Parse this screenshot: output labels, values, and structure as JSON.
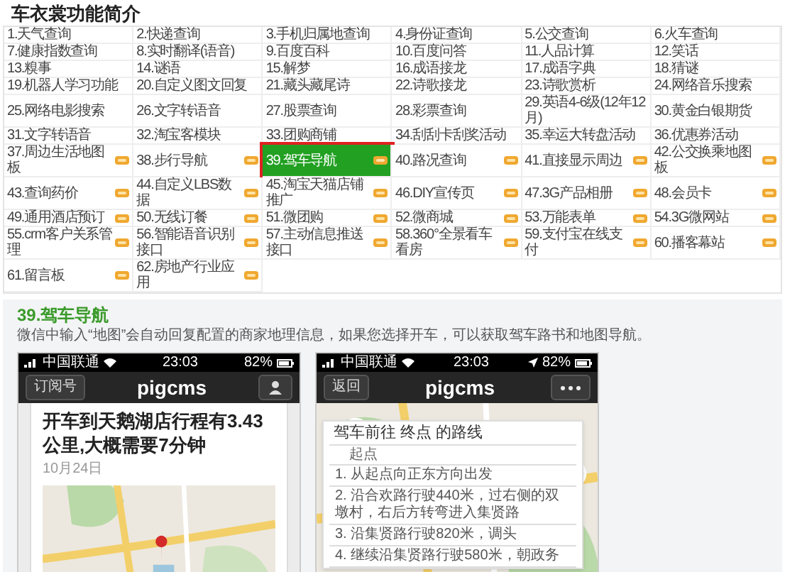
{
  "title": "车衣裳功能简介",
  "features": [
    {
      "label": "1.天气查询",
      "new": false,
      "selected": false
    },
    {
      "label": "2.快递查询",
      "new": false,
      "selected": false
    },
    {
      "label": "3.手机归属地查询",
      "new": false,
      "selected": false
    },
    {
      "label": "4.身份证查询",
      "new": false,
      "selected": false
    },
    {
      "label": "5.公交查询",
      "new": false,
      "selected": false
    },
    {
      "label": "6.火车查询",
      "new": false,
      "selected": false
    },
    {
      "label": "7.健康指数查询",
      "new": false,
      "selected": false
    },
    {
      "label": "8.实时翻译(语音)",
      "new": false,
      "selected": false
    },
    {
      "label": "9.百度百科",
      "new": false,
      "selected": false
    },
    {
      "label": "10.百度问答",
      "new": false,
      "selected": false
    },
    {
      "label": "11.人品计算",
      "new": false,
      "selected": false
    },
    {
      "label": "12.笑话",
      "new": false,
      "selected": false
    },
    {
      "label": "13.糗事",
      "new": false,
      "selected": false
    },
    {
      "label": "14.谜语",
      "new": false,
      "selected": false
    },
    {
      "label": "15.解梦",
      "new": false,
      "selected": false
    },
    {
      "label": "16.成语接龙",
      "new": false,
      "selected": false
    },
    {
      "label": "17.成语字典",
      "new": false,
      "selected": false
    },
    {
      "label": "18.猜谜",
      "new": false,
      "selected": false
    },
    {
      "label": "19.机器人学习功能",
      "new": false,
      "selected": false
    },
    {
      "label": "20.自定义图文回复",
      "new": false,
      "selected": false
    },
    {
      "label": "21.藏头藏尾诗",
      "new": false,
      "selected": false
    },
    {
      "label": "22.诗歌接龙",
      "new": false,
      "selected": false
    },
    {
      "label": "23.诗歌赏析",
      "new": false,
      "selected": false
    },
    {
      "label": "24.网络音乐搜索",
      "new": false,
      "selected": false
    },
    {
      "label": "25.网络电影搜索",
      "new": false,
      "selected": false
    },
    {
      "label": "26.文字转语音",
      "new": false,
      "selected": false
    },
    {
      "label": "27.股票查询",
      "new": false,
      "selected": false
    },
    {
      "label": "28.彩票查询",
      "new": false,
      "selected": false
    },
    {
      "label": "29.英语4-6级(12年12月)",
      "new": false,
      "selected": false
    },
    {
      "label": "30.黄金白银期货",
      "new": false,
      "selected": false
    },
    {
      "label": "31.文字转语音",
      "new": false,
      "selected": false
    },
    {
      "label": "32.淘宝客模块",
      "new": false,
      "selected": false
    },
    {
      "label": "33.团购商铺",
      "new": false,
      "selected": false
    },
    {
      "label": "34.刮刮卡刮奖活动",
      "new": false,
      "selected": false
    },
    {
      "label": "35.幸运大转盘活动",
      "new": false,
      "selected": false
    },
    {
      "label": "36.优惠券活动",
      "new": false,
      "selected": false
    },
    {
      "label": "37.周边生活地图板",
      "new": true,
      "selected": false
    },
    {
      "label": "38.步行导航",
      "new": true,
      "selected": false
    },
    {
      "label": "39.驾车导航",
      "new": true,
      "selected": true
    },
    {
      "label": "40.路况查询",
      "new": true,
      "selected": false
    },
    {
      "label": "41.直接显示周边",
      "new": true,
      "selected": false
    },
    {
      "label": "42.公交换乘地图板",
      "new": true,
      "selected": false
    },
    {
      "label": "43.查询药价",
      "new": true,
      "selected": false
    },
    {
      "label": "44.自定义LBS数据",
      "new": true,
      "selected": false
    },
    {
      "label": "45.淘宝天猫店铺推广",
      "new": true,
      "selected": false
    },
    {
      "label": "46.DIY宣传页",
      "new": true,
      "selected": false
    },
    {
      "label": "47.3G产品相册",
      "new": true,
      "selected": false
    },
    {
      "label": "48.会员卡",
      "new": true,
      "selected": false
    },
    {
      "label": "49.通用酒店预订",
      "new": true,
      "selected": false
    },
    {
      "label": "50.无线订餐",
      "new": true,
      "selected": false
    },
    {
      "label": "51.微团购",
      "new": true,
      "selected": false
    },
    {
      "label": "52.微商城",
      "new": true,
      "selected": false
    },
    {
      "label": "53.万能表单",
      "new": true,
      "selected": false
    },
    {
      "label": "54.3G微网站",
      "new": true,
      "selected": false
    },
    {
      "label": "55.crm客户关系管理",
      "new": true,
      "selected": false
    },
    {
      "label": "56.智能语音识别接口",
      "new": true,
      "selected": false
    },
    {
      "label": "57.主动信息推送接口",
      "new": true,
      "selected": false
    },
    {
      "label": "58.360°全景看车看房",
      "new": true,
      "selected": false
    },
    {
      "label": "59.支付宝在线支付",
      "new": true,
      "selected": false
    },
    {
      "label": "60.播客幕站",
      "new": true,
      "selected": false
    },
    {
      "label": "61.留言板",
      "new": true,
      "selected": false
    },
    {
      "label": "62.房地产行业应用",
      "new": true,
      "selected": false
    }
  ],
  "detail": {
    "heading": "39.驾车导航",
    "description": "微信中输入“地图”会自动回复配置的商家地理信息，如果您选择开车，可以获取驾车路书和地图导航。",
    "phones": [
      {
        "kind": "article",
        "carrier": "中国联通",
        "time": "23:03",
        "battery": "82%",
        "location": false,
        "back": "订阅号",
        "nav_title": "pigcms",
        "right_button": {
          "kind": "profile"
        },
        "headline": "开车到天鹅湖店行程有3.43公里,大概需要7分钟",
        "date": "10月24日"
      },
      {
        "kind": "route",
        "carrier": "中国联通",
        "time": "23:03",
        "battery": "82%",
        "location": true,
        "back": "返回",
        "nav_title": "pigcms",
        "right_button": {
          "kind": "more"
        },
        "route_title": "驾车前往 终点 的路线",
        "start": "起点",
        "steps": [
          "1. 从起点向正东方向出发",
          "2. 沿合欢路行驶440米，过右侧的双墩村，右后方转弯进入集贤路",
          "3. 沿集贤路行驶820米，调头",
          "4. 继续沿集贤路行驶580米，朝政务"
        ]
      }
    ]
  }
}
